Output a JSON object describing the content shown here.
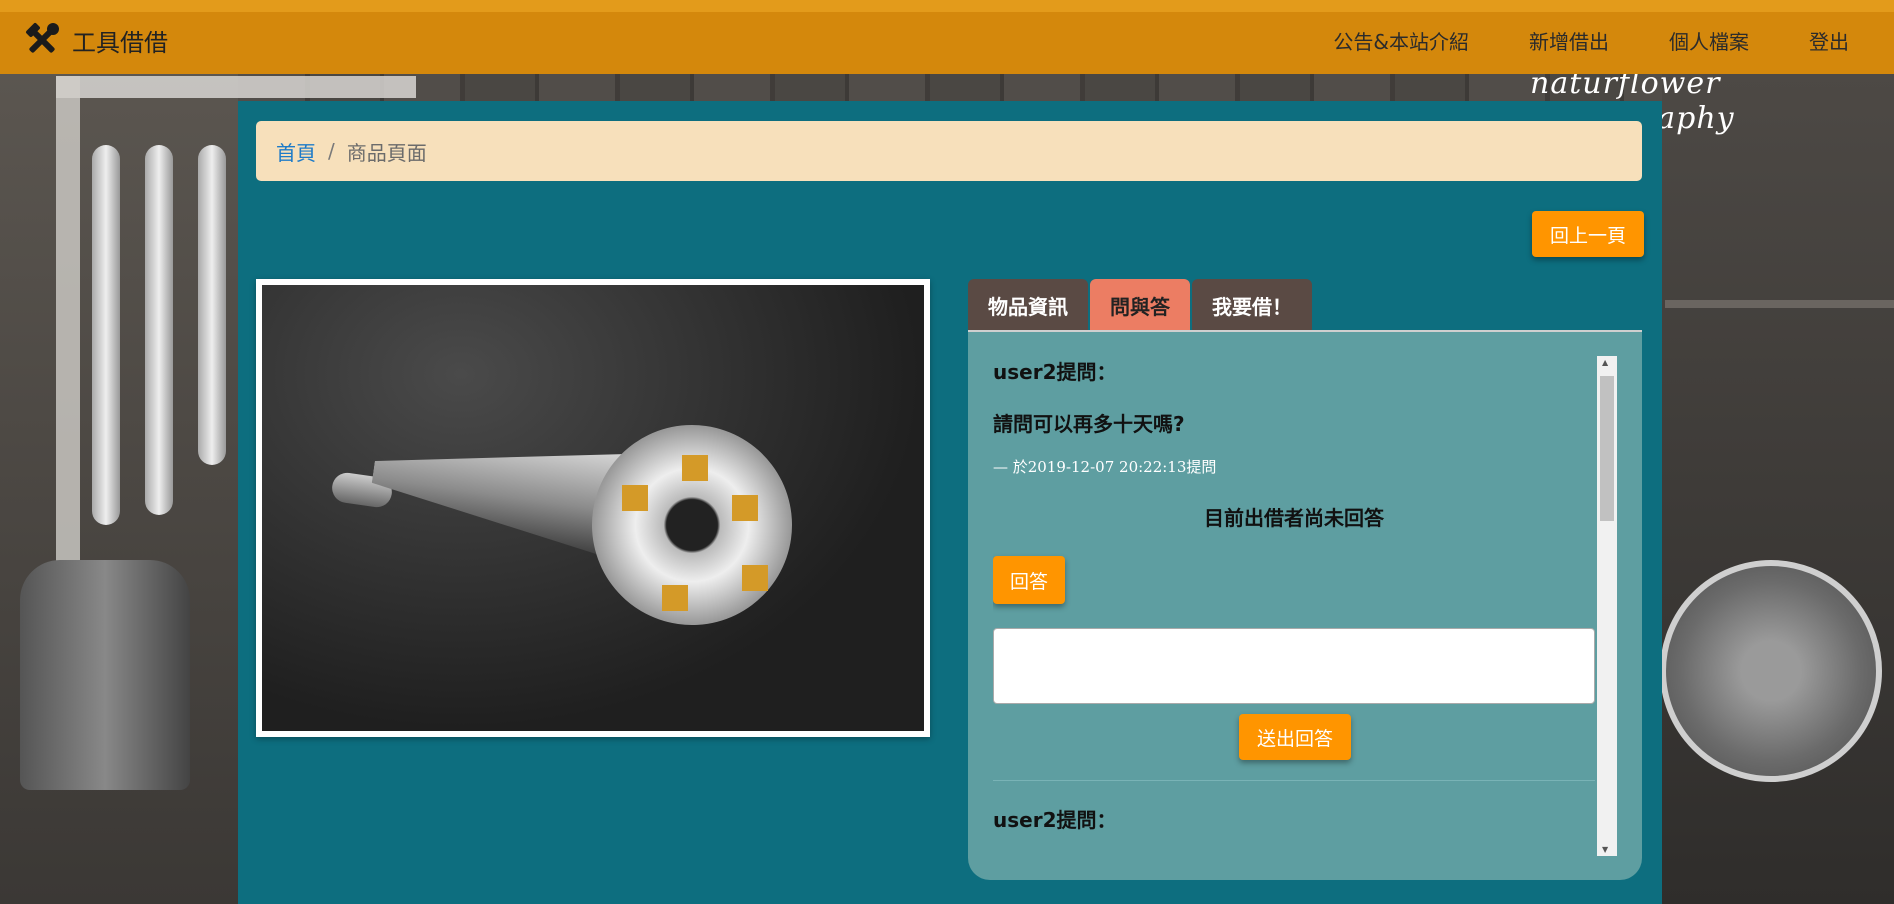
{
  "navbar": {
    "brand": "工具借借",
    "links": [
      "公告&本站介紹",
      "新增借出",
      "個人檔案",
      "登出"
    ]
  },
  "background": {
    "watermark": "naturflower photography"
  },
  "breadcrumb": {
    "home": "首頁",
    "separator": "/",
    "current": "商品頁面"
  },
  "back_button": "回上一頁",
  "tabs": [
    {
      "label": "物品資訊",
      "active": false
    },
    {
      "label": "問與答",
      "active": true
    },
    {
      "label": "我要借！",
      "active": false
    }
  ],
  "qa": {
    "items": [
      {
        "author": "user2提問：",
        "question": "請問可以再多十天嗎?",
        "time": "— 於2019-12-07 20:22:13提問",
        "status": "目前出借者尚未回答",
        "reply_label": "回答",
        "textarea_value": "",
        "send_label": "送出回答"
      },
      {
        "author": "user2提問："
      }
    ]
  },
  "colors": {
    "navbar": "#d4880c",
    "container": "#0d6e7f",
    "breadcrumb_bg": "#f7e0bb",
    "accent_button": "#ff9500",
    "tab_inactive": "#5a4a44",
    "tab_active": "#ec7d63",
    "qa_panel": "#5e9ea1"
  }
}
